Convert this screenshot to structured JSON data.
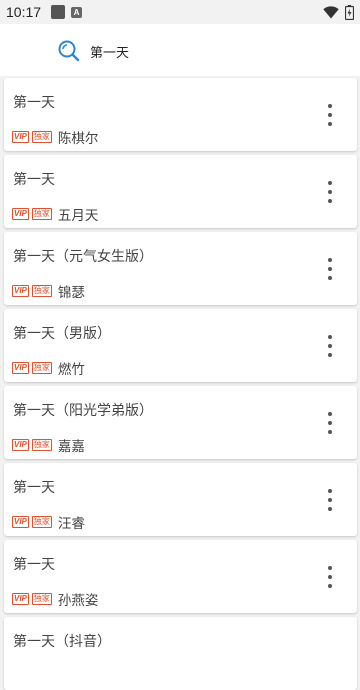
{
  "status_bar": {
    "time": "10:17",
    "notif_letter": "A"
  },
  "search": {
    "query": "第一天"
  },
  "results": [
    {
      "title": "第一天",
      "tags": [
        "VIP",
        "独家"
      ],
      "author": "陈棋尔"
    },
    {
      "title": "第一天",
      "tags": [
        "VIP",
        "独家"
      ],
      "author": "五月天"
    },
    {
      "title": "第一天（元气女生版）",
      "tags": [
        "VIP",
        "独家"
      ],
      "author": "锦瑟"
    },
    {
      "title": "第一天（男版）",
      "tags": [
        "VIP",
        "独家"
      ],
      "author": "燃竹"
    },
    {
      "title": "第一天（阳光学弟版）",
      "tags": [
        "VIP",
        "独家"
      ],
      "author": "嘉嘉"
    },
    {
      "title": "第一天",
      "tags": [
        "VIP",
        "独家"
      ],
      "author": "汪睿"
    },
    {
      "title": "第一天",
      "tags": [
        "VIP",
        "独家"
      ],
      "author": "孙燕姿"
    },
    {
      "title": "第一天（抖音）",
      "tags": [],
      "author": ""
    }
  ],
  "colors": {
    "tag": "#e2512e",
    "search_icon": "#2f86d6"
  }
}
